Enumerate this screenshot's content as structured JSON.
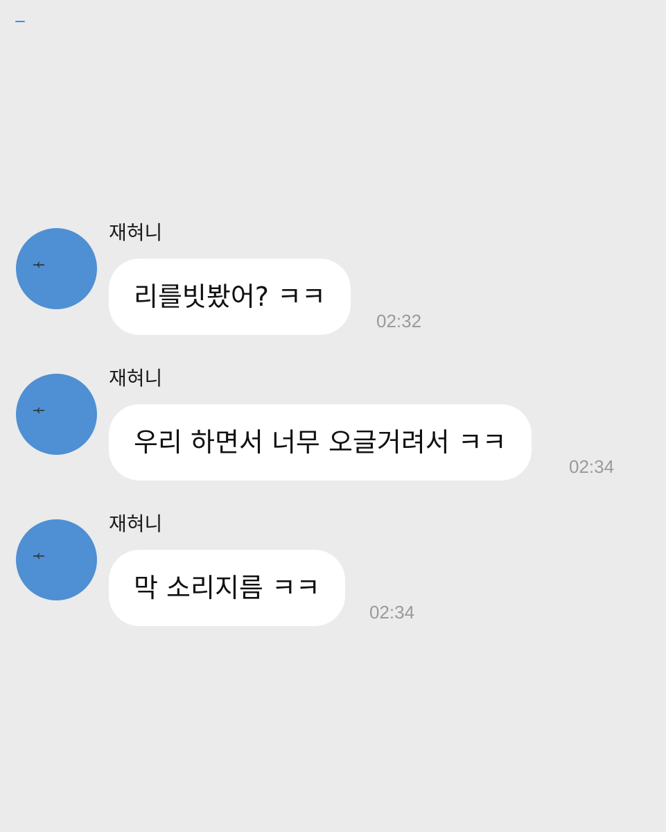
{
  "messages": [
    {
      "sender": "재혀니",
      "text": "리를빗봤어? ㅋㅋ",
      "time": "02:32"
    },
    {
      "sender": "재혀니",
      "text": "우리 하면서 너무 오글거려서 ㅋㅋ",
      "time": "02:34"
    },
    {
      "sender": "재혀니",
      "text": "막 소리지름 ㅋㅋ",
      "time": "02:34"
    }
  ],
  "avatar": {
    "color": "#4f8fd3",
    "icon": "airplane-icon"
  },
  "colors": {
    "background": "#ebebeb",
    "bubble": "#ffffff",
    "timestamp": "#9a9a9a"
  }
}
